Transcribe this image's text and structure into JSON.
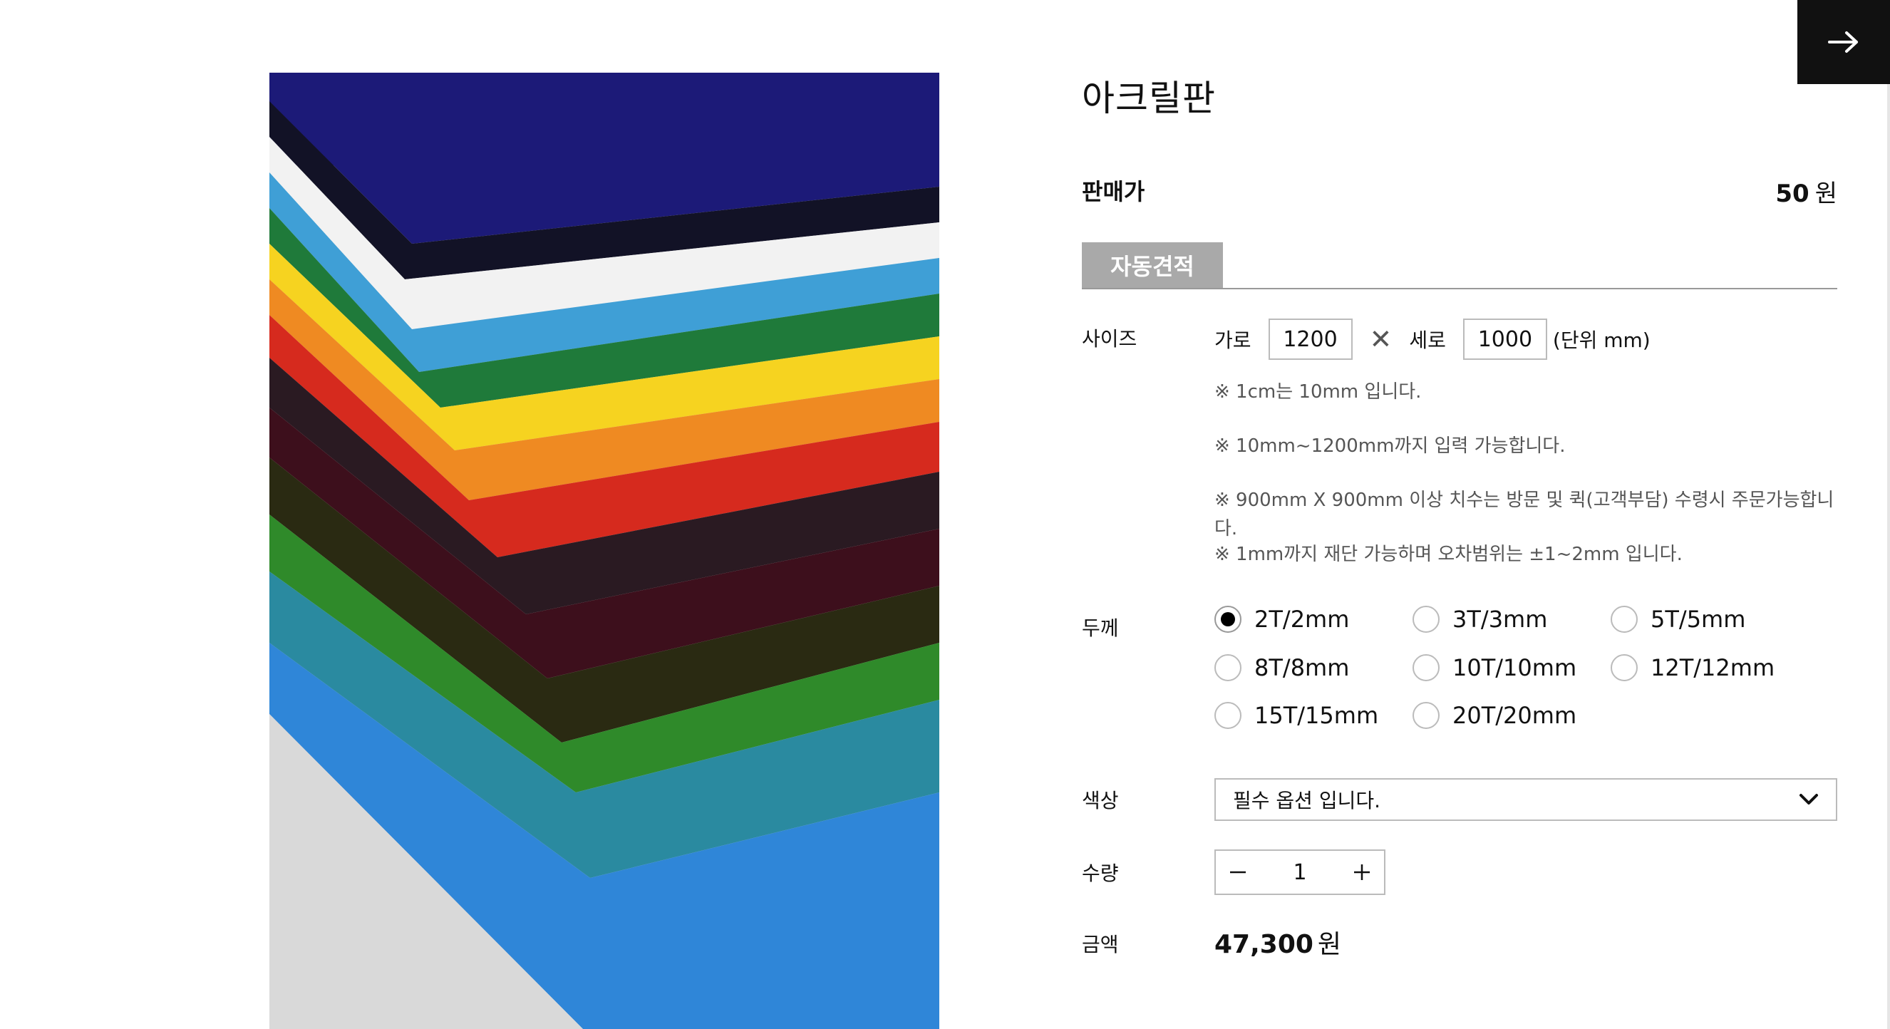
{
  "product": {
    "title": "아크릴판",
    "price_label": "판매가",
    "price_value": "50",
    "price_unit": "원"
  },
  "tab": {
    "label": "자동견적"
  },
  "size": {
    "label": "사이즈",
    "width_label": "가로",
    "width_value": "1200",
    "height_label": "세로",
    "height_value": "1000",
    "unit_note": "(단위 mm)",
    "notes": [
      "※ 1cm는 10mm 입니다.",
      "※ 10mm~1200mm까지 입력 가능합니다.",
      "※ 900mm X 900mm 이상 치수는 방문 및 퀵(고객부담) 수령시 주문가능합니다.",
      "※ 1mm까지 재단 가능하며 오차범위는 ±1~2mm 입니다."
    ]
  },
  "thickness": {
    "label": "두께",
    "selected": "2T/2mm",
    "options": [
      "2T/2mm",
      "3T/3mm",
      "5T/5mm",
      "8T/8mm",
      "10T/10mm",
      "12T/12mm",
      "15T/15mm",
      "20T/20mm"
    ]
  },
  "color": {
    "label": "색상",
    "placeholder": "필수 옵션 입니다."
  },
  "quantity": {
    "label": "수량",
    "value": "1"
  },
  "total": {
    "label": "금액",
    "value": "47,300",
    "unit": "원"
  },
  "icons": {
    "next": "arrow-right-icon",
    "dropdown": "chevron-down-icon",
    "minus": "minus-icon",
    "plus": "plus-icon",
    "times": "multiply-icon"
  },
  "colors": {
    "tab_bg": "#a9a9a9",
    "nav_button_bg": "#111111",
    "border": "#bbbbbb"
  }
}
